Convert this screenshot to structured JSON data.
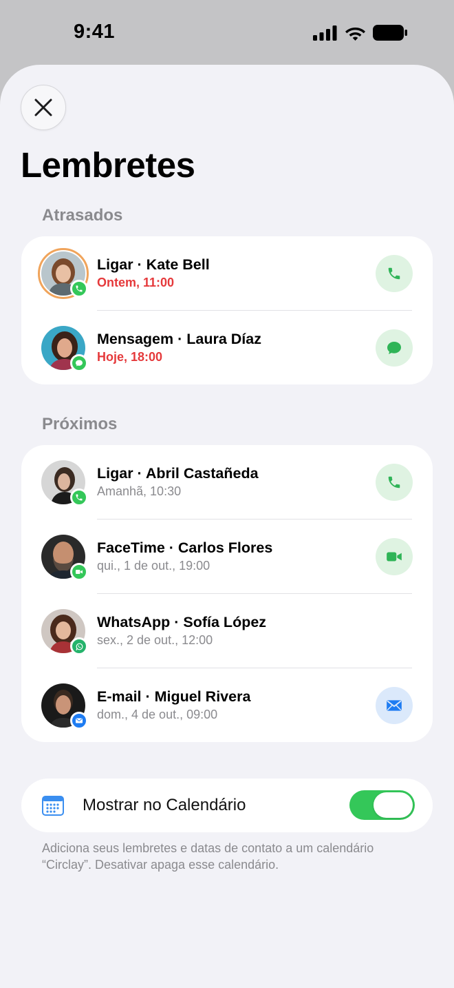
{
  "status_bar": {
    "time": "9:41",
    "icons": [
      "cellular-signal-icon",
      "wifi-icon",
      "battery-icon"
    ]
  },
  "sheet": {
    "close_icon": "close-icon",
    "title": "Lembretes"
  },
  "sections": [
    {
      "label": "Atrasados",
      "items": [
        {
          "title": "Ligar · Kate Bell",
          "subtitle": "Ontem, 11:00",
          "late": true,
          "badge": "phone-icon",
          "action": "phone-icon",
          "action_style": "green"
        },
        {
          "title": "Mensagem · Laura Díaz",
          "subtitle": "Hoje, 18:00",
          "late": true,
          "badge": "message-icon",
          "action": "message-icon",
          "action_style": "green"
        }
      ]
    },
    {
      "label": "Próximos",
      "items": [
        {
          "title": "Ligar · Abril Castañeda",
          "subtitle": "Amanhã, 10:30",
          "late": false,
          "badge": "phone-icon",
          "action": "phone-icon",
          "action_style": "green"
        },
        {
          "title": "FaceTime · Carlos Flores",
          "subtitle": "qui., 1 de out., 19:00",
          "late": false,
          "badge": "video-icon",
          "action": "video-icon",
          "action_style": "green"
        },
        {
          "title": "WhatsApp · Sofía López",
          "subtitle": "sex., 2 de out., 12:00",
          "late": false,
          "badge": "whatsapp-icon",
          "action": "",
          "action_style": ""
        },
        {
          "title": "E-mail · Miguel Rivera",
          "subtitle": "dom., 4 de out., 09:00",
          "late": false,
          "badge": "mail-icon",
          "action": "mail-icon",
          "action_style": "blue"
        }
      ]
    }
  ],
  "calendar_setting": {
    "icon": "calendar-icon",
    "label": "Mostrar no Calendário",
    "enabled": true
  },
  "footnote": "Adiciona seus lembretes e datas de contato a um calendário “Circlay”. Desativar apaga esse calendário.",
  "colors": {
    "accent_green": "#34c759",
    "late_red": "#e5393b",
    "mail_blue": "#1e7cf2",
    "whatsapp_green": "#25b36b"
  }
}
